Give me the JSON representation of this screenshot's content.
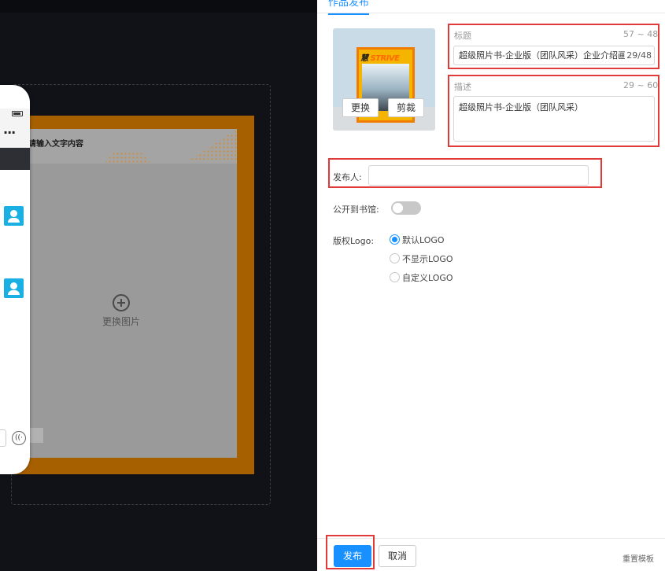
{
  "canvas": {
    "hint_text": "请输入文字内容",
    "replace_image_label": "更换图片"
  },
  "phone": {
    "more_icon": "···",
    "voice_icon": "((·"
  },
  "panel": {
    "tab_label": "作品发布",
    "cover": {
      "book_title_a": "慧",
      "book_title_b": "STRIVE",
      "replace_button": "更换",
      "crop_button": "剪裁"
    },
    "title_field": {
      "label": "标题",
      "limit": "57 ~ 48",
      "value": "超级照片书-企业版（团队风采）企业介绍画册",
      "count": "29/48"
    },
    "desc_field": {
      "label": "描述",
      "limit": "29 ~ 60",
      "value": "超级照片书-企业版（团队风采）"
    },
    "publisher": {
      "label": "发布人:",
      "value": ""
    },
    "library": {
      "label": "公开到书馆:",
      "enabled": false
    },
    "copyright": {
      "label": "版权Logo:",
      "options": [
        "默认LOGO",
        "不显示LOGO",
        "自定义LOGO"
      ],
      "selected": "默认LOGO"
    },
    "footer": {
      "publish_button": "发布",
      "cancel_button": "取消",
      "reset_link": "重置模板"
    }
  },
  "colors": {
    "accent": "#1890ff",
    "highlight_border": "#e03a3a",
    "frame_orange": "#a76000"
  }
}
